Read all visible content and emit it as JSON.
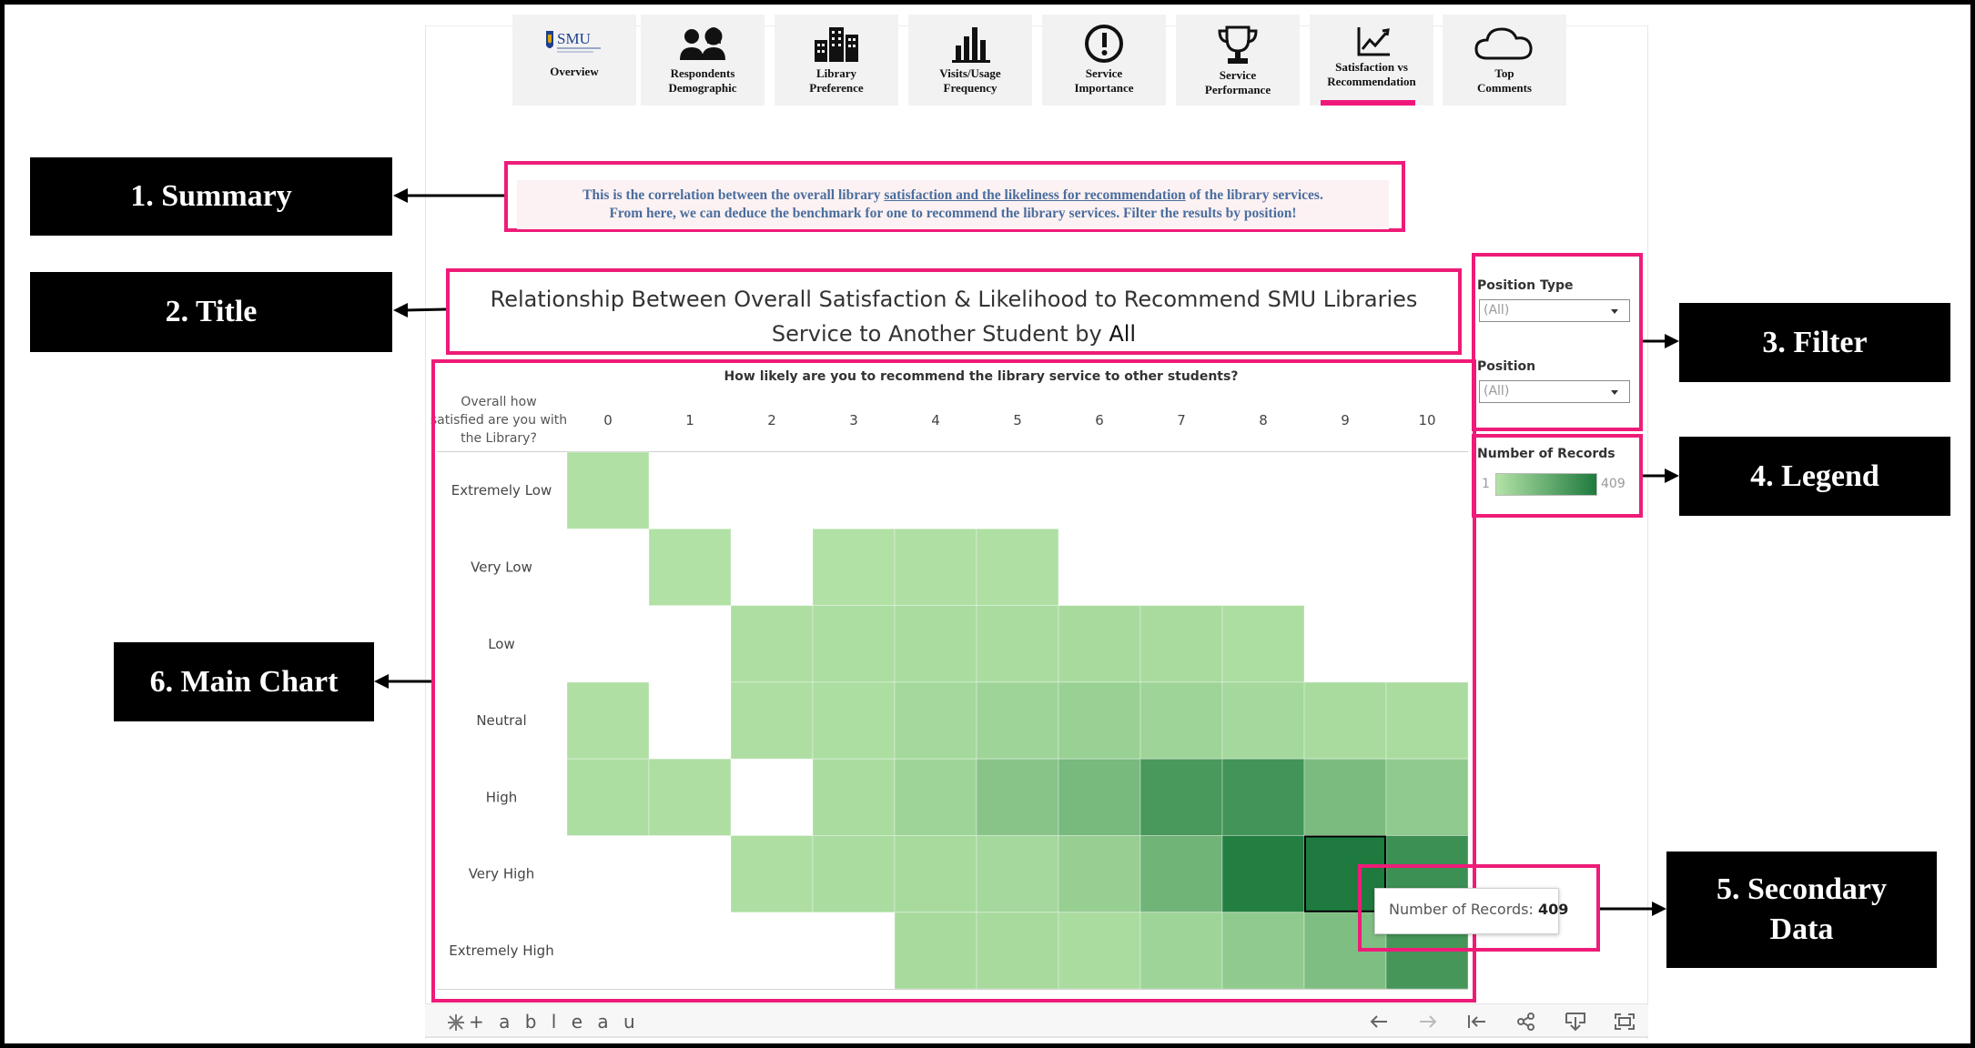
{
  "nav": {
    "tabs": [
      {
        "label": "Overview",
        "icon": "smu-logo-icon",
        "active": false
      },
      {
        "label": "Respondents\nDemographic",
        "icon": "people-icon",
        "active": false
      },
      {
        "label": "Library\nPreference",
        "icon": "building-icon",
        "active": false
      },
      {
        "label": "Visits/Usage\nFrequency",
        "icon": "bar-chart-icon",
        "active": false
      },
      {
        "label": "Service\nImportance",
        "icon": "exclamation-icon",
        "active": false
      },
      {
        "label": "Service\nPerformance",
        "icon": "trophy-icon",
        "active": false
      },
      {
        "label": "Satisfaction vs\nRecommendation",
        "icon": "line-chart-icon",
        "active": true
      },
      {
        "label": "Top\nComments",
        "icon": "cloud-icon",
        "active": false
      }
    ],
    "logo_text": "SMU"
  },
  "summary": {
    "line1_pre": "This is the correlation between the overall library ",
    "line1_link": "satisfaction and the likeliness for recommendation",
    "line1_post": " of the library services.",
    "line2": "From here, we can deduce the benchmark for one to recommend the library services. Filter the results by position!"
  },
  "title": {
    "text": "Relationship Between Overall Satisfaction & Likelihood to Recommend SMU Libraries Service to Another Student by ",
    "filter_value": "All"
  },
  "filters": {
    "position_type": {
      "label": "Position Type",
      "value": "(All)"
    },
    "position": {
      "label": "Position",
      "value": "(All)"
    }
  },
  "legend": {
    "title": "Number of Records",
    "min": "1",
    "max": "409",
    "color_min": "#b3e2a6",
    "color_max": "#1e7a3e"
  },
  "annotations": {
    "summary": "1. Summary",
    "title": "2. Title",
    "filter": "3. Filter",
    "legend": "4. Legend",
    "secondary": "5. Secondary\nData",
    "main_chart": "6. Main Chart"
  },
  "tooltip": {
    "label": "Number of Records:",
    "value": "409"
  },
  "tableau": {
    "logo": "+ a b l e a u"
  },
  "accent_color": "#ee1c78",
  "chart_data": {
    "type": "heatmap",
    "title": "How likely are you to recommend the library service to other students?",
    "ylabel": "Overall how satisfied are you with the Library?",
    "x_categories": [
      "0",
      "1",
      "2",
      "3",
      "4",
      "5",
      "6",
      "7",
      "8",
      "9",
      "10"
    ],
    "y_categories": [
      "Extremely Low",
      "Very Low",
      "Low",
      "Neutral",
      "High",
      "Very High",
      "Extremely High"
    ],
    "color_range": [
      1,
      409
    ],
    "values": [
      [
        3,
        null,
        null,
        null,
        null,
        null,
        null,
        null,
        null,
        null,
        null
      ],
      [
        null,
        2,
        null,
        2,
        4,
        4,
        null,
        null,
        null,
        null,
        null
      ],
      [
        null,
        null,
        6,
        8,
        10,
        10,
        14,
        12,
        8,
        null,
        null
      ],
      [
        4,
        null,
        6,
        8,
        20,
        30,
        40,
        30,
        20,
        12,
        10
      ],
      [
        8,
        6,
        null,
        10,
        30,
        80,
        120,
        260,
        280,
        110,
        60
      ],
      [
        null,
        null,
        6,
        10,
        14,
        20,
        45,
        140,
        390,
        409,
        300
      ],
      [
        null,
        null,
        null,
        null,
        14,
        14,
        10,
        30,
        60,
        100,
        270
      ]
    ],
    "highlight": {
      "row": "Very High",
      "col": "9",
      "value": 409
    }
  }
}
